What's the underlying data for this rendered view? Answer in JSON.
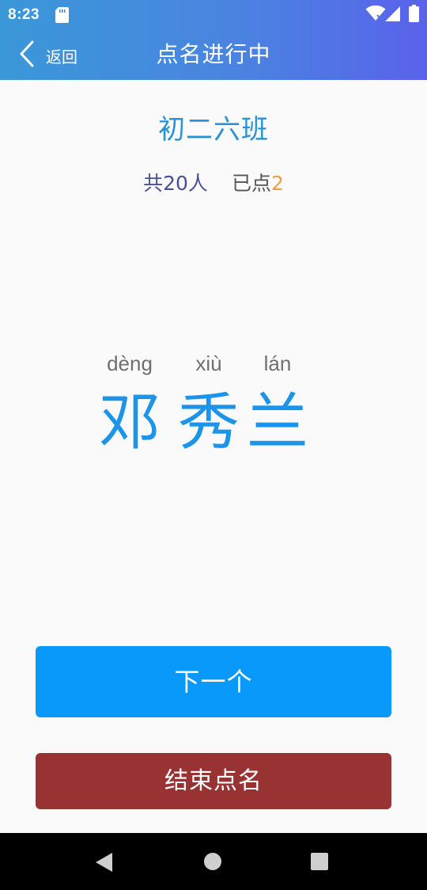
{
  "status_bar": {
    "time": "8:23",
    "icons": [
      "sd-card-icon",
      "wifi-icon",
      "signal-icon",
      "battery-icon"
    ]
  },
  "app_bar": {
    "back_label": "返回",
    "title": "点名进行中",
    "gradient": [
      "#3a98d8",
      "#5a62ec"
    ]
  },
  "class_info": {
    "name": "初二六班",
    "total_text": "共20人",
    "called_label": "已点",
    "called_count": "2"
  },
  "student": {
    "chars": [
      {
        "pinyin": "dèng",
        "hanzi": "邓"
      },
      {
        "pinyin": "xiù",
        "hanzi": "秀"
      },
      {
        "pinyin": "lán",
        "hanzi": "兰"
      }
    ]
  },
  "actions": {
    "next_label": "下一个",
    "end_label": "结束点名"
  },
  "colors": {
    "accent": "#0999fb",
    "name": "#1b94ea",
    "end_button": "#993333",
    "called_count": "#f39a45",
    "class_name": "#2a93d5"
  },
  "nav_bar": {
    "icons": [
      "nav-back-icon",
      "nav-home-icon",
      "nav-recents-icon"
    ]
  }
}
